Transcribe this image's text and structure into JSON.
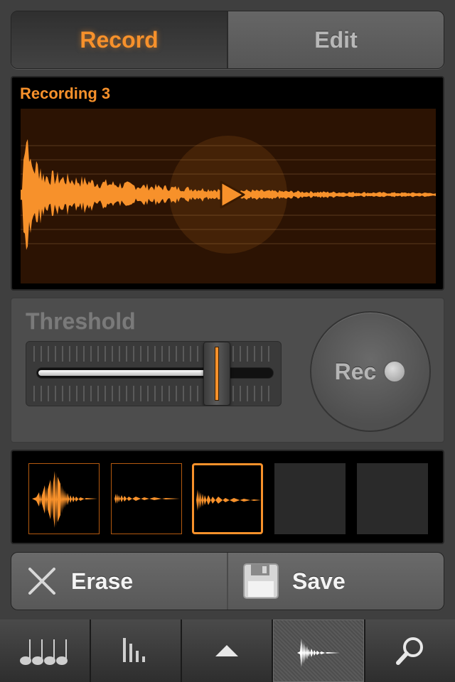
{
  "segmented": {
    "record_label": "Record",
    "edit_label": "Edit",
    "active": "record"
  },
  "waveform": {
    "title": "Recording 3",
    "play_icon": "play-icon",
    "accent_color": "#f7912b",
    "background_color": "#2c1303"
  },
  "threshold": {
    "label": "Threshold",
    "value_fraction": 0.76
  },
  "rec_button": {
    "label": "Rec",
    "icon": "record-dot-icon"
  },
  "slots": [
    {
      "state": "filled",
      "icon": "waveform-thumbnail-icon"
    },
    {
      "state": "filled",
      "icon": "waveform-thumbnail-icon"
    },
    {
      "state": "selected",
      "icon": "waveform-thumbnail-icon"
    },
    {
      "state": "empty"
    },
    {
      "state": "empty"
    }
  ],
  "actions": {
    "erase_label": "Erase",
    "erase_icon": "close-x-icon",
    "save_label": "Save",
    "save_icon": "floppy-disk-icon"
  },
  "tabs": [
    {
      "icon": "music-notes-icon"
    },
    {
      "icon": "bars-icon"
    },
    {
      "icon": "chevron-up-icon"
    },
    {
      "icon": "waveform-icon",
      "active": true
    },
    {
      "icon": "search-icon"
    }
  ]
}
